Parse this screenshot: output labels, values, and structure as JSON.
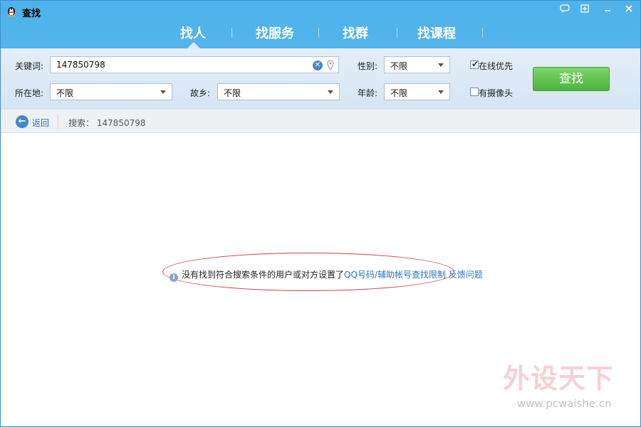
{
  "window": {
    "title": "查找"
  },
  "titlebar_icons": {
    "chat": "chat-bubble-icon",
    "skin": "skin-icon",
    "minimize": "minimize-icon",
    "close": "close-icon"
  },
  "tabs": [
    {
      "label": "找人",
      "active": true
    },
    {
      "label": "找服务",
      "active": false
    },
    {
      "label": "找群",
      "active": false
    },
    {
      "label": "找课程",
      "active": false
    }
  ],
  "filters": {
    "keyword": {
      "label": "关键词:",
      "value": "147850798"
    },
    "gender": {
      "label": "性别:",
      "value": "不限"
    },
    "online_first": {
      "label": "在线优先",
      "checked": true
    },
    "location": {
      "label": "所在地:",
      "value": "不限"
    },
    "hometown": {
      "label": "故乡:",
      "value": "不限"
    },
    "age": {
      "label": "年龄:",
      "value": "不限"
    },
    "has_camera": {
      "label": "有摄像头",
      "checked": false
    }
  },
  "search_button": {
    "label": "查找"
  },
  "breadcrumb": {
    "back_label": "返回",
    "search_text": "搜索： 147850798"
  },
  "result_message": {
    "text": "没有找到符合搜索条件的用户或对方设置了",
    "link_restriction": "QQ号码/辅助帐号查找限制",
    "link_feedback": "反馈问题"
  },
  "watermark": {
    "logo_text": "外设天下",
    "url": "www.pcwaishe.cn"
  },
  "colors": {
    "header_blue": "#4fb2ea",
    "button_green": "#5cc04a",
    "link_blue": "#2b74c2",
    "ellipse_red": "#d24040"
  }
}
